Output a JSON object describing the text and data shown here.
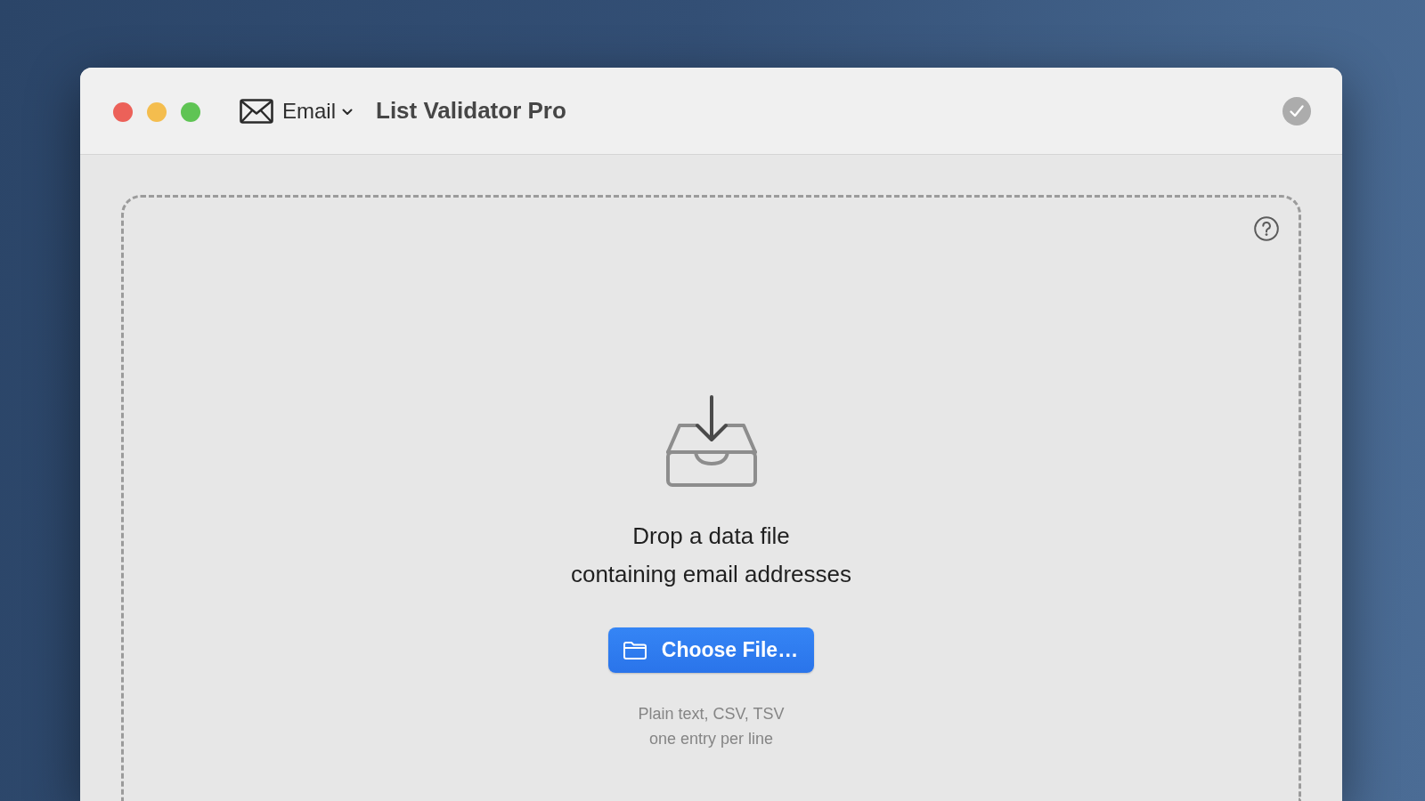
{
  "window": {
    "title": "List Validator Pro"
  },
  "toolbar": {
    "mode_menu": {
      "label": "Email"
    }
  },
  "drop_zone": {
    "message": "Drop a data file\ncontaining email addresses",
    "button": {
      "label": "Choose File…"
    },
    "hint": "Plain text, CSV, TSV\none entry per line"
  }
}
